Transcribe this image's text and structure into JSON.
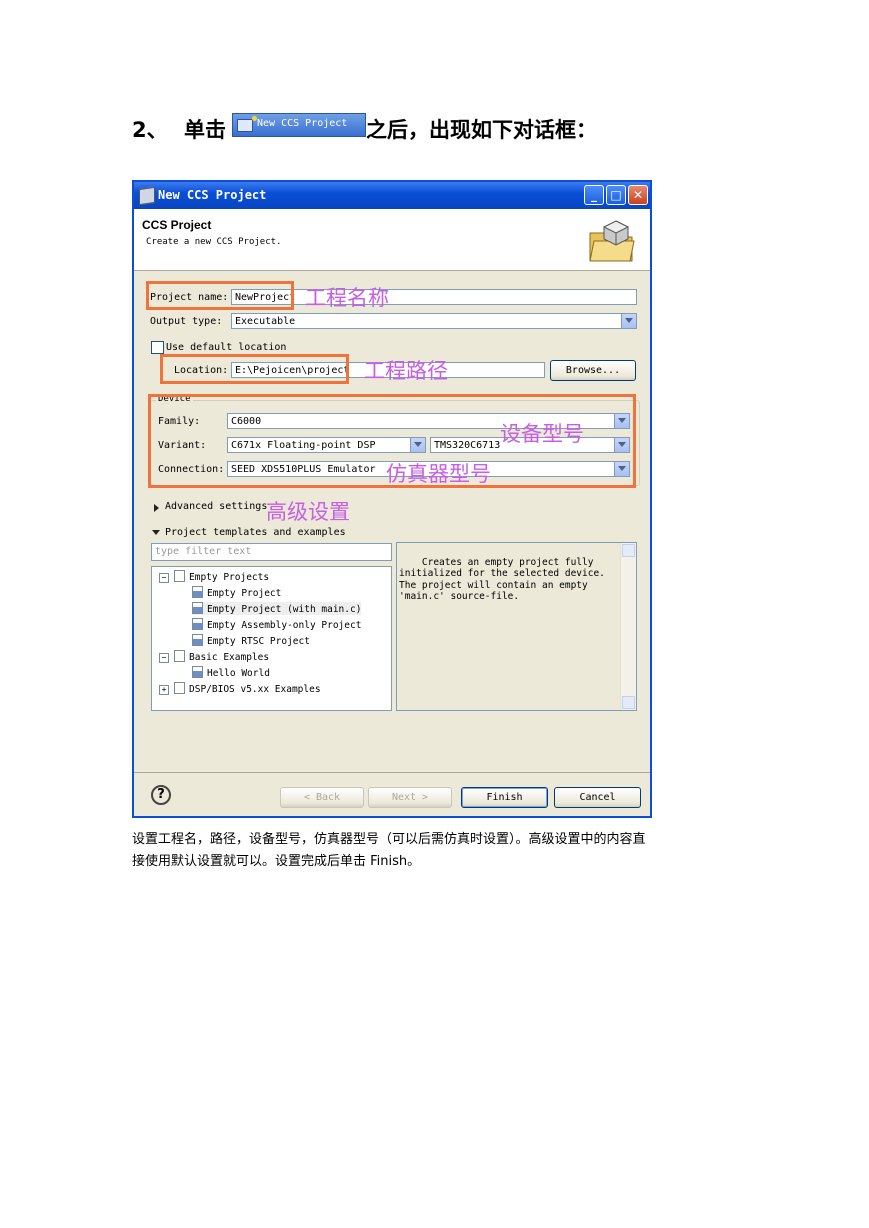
{
  "heading": {
    "number": "2、",
    "before": "单击",
    "after": "之后，出现如下对话框：",
    "inline_button_label": "New CCS Project"
  },
  "dialog": {
    "title": "New CCS Project",
    "header_title": "CCS Project",
    "header_subtitle": "Create a new CCS Project.",
    "project_name_label": "Project name:",
    "project_name_value": "NewProject",
    "output_type_label": "Output type:",
    "output_type_value": "Executable",
    "use_default_location_label": "Use default location",
    "location_label": "Location:",
    "location_value": "E:\\Pejoicen\\project",
    "browse_label": "Browse...",
    "device_group_label": "Device",
    "family_label": "Family:",
    "family_value": "C6000",
    "variant_label": "Variant:",
    "variant_value": "C671x Floating-point DSP",
    "variant_device_value": "TMS320C6713",
    "connection_label": "Connection:",
    "connection_value": "SEED XDS510PLUS Emulator",
    "advanced_settings_label": "Advanced settings",
    "templates_label": "Project templates and examples",
    "filter_placeholder": "type filter text",
    "tree": [
      {
        "label": "Empty Projects",
        "level": 0,
        "expander": "−"
      },
      {
        "label": "Empty Project",
        "level": 1
      },
      {
        "label": "Empty Project (with main.c)",
        "level": 1,
        "selected": true
      },
      {
        "label": "Empty Assembly-only Project",
        "level": 1
      },
      {
        "label": "Empty RTSC Project",
        "level": 1
      },
      {
        "label": "Basic Examples",
        "level": 0,
        "expander": "−"
      },
      {
        "label": "Hello World",
        "level": 1
      },
      {
        "label": "DSP/BIOS v5.xx Examples",
        "level": 0,
        "expander": "+"
      }
    ],
    "description": "Creates an empty project fully\ninitialized for the selected device.\nThe project will contain an empty\n'main.c' source-file.",
    "back_label": "< Back",
    "next_label": "Next >",
    "finish_label": "Finish",
    "cancel_label": "Cancel",
    "help_label": "?"
  },
  "annotations": {
    "project_name": "工程名称",
    "location": "工程路径",
    "device": "设备型号",
    "emulator": "仿真器型号",
    "advanced": "高级设置",
    "box_color": "#f0733c",
    "text_color": "#c85ee6"
  },
  "paragraph": {
    "line1": "设置工程名，路径，设备型号，仿真器型号（可以后需仿真时设置）。高级设置中的内容直",
    "line2": "接使用默认设置就可以。设置完成后单击 Finish。"
  }
}
